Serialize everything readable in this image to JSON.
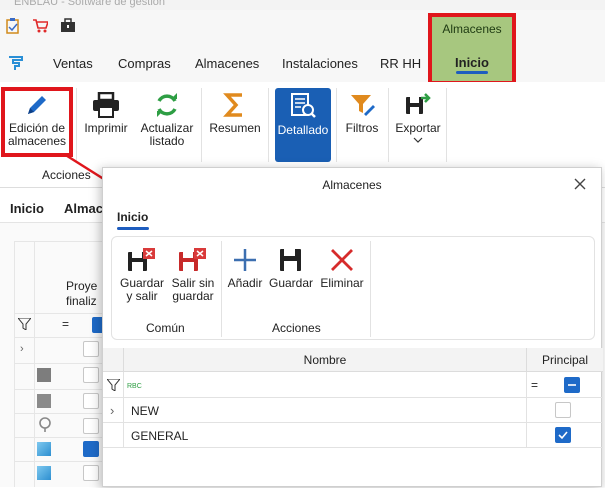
{
  "app": {
    "title": "ENBLAU - Software de gestión"
  },
  "contextual": {
    "group_label": "Almacenes",
    "tab_label": "Inicio"
  },
  "menu": {
    "tabs": [
      "Ventas",
      "Compras",
      "Almacenes",
      "Instalaciones",
      "RR HH"
    ]
  },
  "ribbon": {
    "buttons": [
      {
        "line1": "Edición de",
        "line2": "almacenes"
      },
      {
        "line1": "Imprimir",
        "line2": ""
      },
      {
        "line1": "Actualizar",
        "line2": "listado"
      },
      {
        "line1": "Resumen",
        "line2": ""
      },
      {
        "line1": "Detallado",
        "line2": ""
      },
      {
        "line1": "Filtros",
        "line2": ""
      },
      {
        "line1": "Exportar",
        "line2": ""
      }
    ],
    "group_label": "Acciones"
  },
  "background": {
    "tabs": [
      "Inicio",
      "Almac"
    ],
    "col_header": {
      "line1": "Proye",
      "line2": "finaliz"
    }
  },
  "dialog": {
    "title": "Almacenes",
    "tab": "Inicio",
    "groups": [
      {
        "label": "Común",
        "buttons": [
          {
            "line1": "Guardar",
            "line2": "y salir"
          },
          {
            "line1": "Salir sin",
            "line2": "guardar"
          }
        ]
      },
      {
        "label": "Acciones",
        "buttons": [
          {
            "line1": "Añadir",
            "line2": ""
          },
          {
            "line1": "Guardar",
            "line2": ""
          },
          {
            "line1": "Eliminar",
            "line2": ""
          }
        ]
      }
    ],
    "grid": {
      "columns": [
        "Nombre",
        "Principal"
      ],
      "rows": [
        {
          "nombre": "NEW",
          "principal": false
        },
        {
          "nombre": "GENERAL",
          "principal": true
        }
      ]
    }
  },
  "colors": {
    "accent": "#1a5fb4",
    "annotation": "#e0161c",
    "contextual_bg": "#a7c77f"
  }
}
